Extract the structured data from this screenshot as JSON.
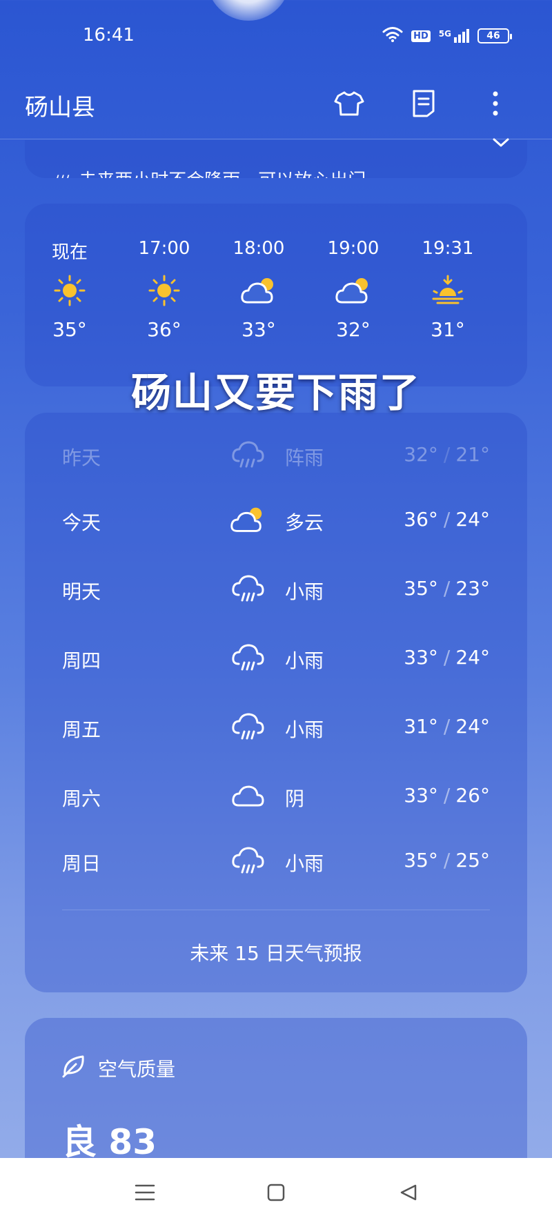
{
  "status_bar": {
    "time": "16:41",
    "hd": "HD",
    "network": "5G",
    "battery": "46",
    "icons": [
      "wifi-icon",
      "hd-icon",
      "5g-signal-icon",
      "battery-icon"
    ]
  },
  "header": {
    "city": "砀山县",
    "icons": [
      "tshirt-icon",
      "note-icon",
      "more-vertical-icon"
    ]
  },
  "alert": {
    "text": "未来两小时不会降雨，可以放心出门"
  },
  "overlay_title": "砀山又要下雨了",
  "hourly": [
    {
      "label": "现在",
      "icon": "sun-icon",
      "temp": "35°"
    },
    {
      "label": "17:00",
      "icon": "sun-icon",
      "temp": "36°"
    },
    {
      "label": "18:00",
      "icon": "partly-cloudy-icon",
      "temp": "33°"
    },
    {
      "label": "19:00",
      "icon": "partly-cloudy-icon",
      "temp": "32°"
    },
    {
      "label": "19:31",
      "icon": "sunset-icon",
      "temp": "31°"
    }
  ],
  "daily": [
    {
      "day": "昨天",
      "icon": "shower-icon",
      "cond": "阵雨",
      "high": "32°",
      "low": "21°",
      "sep": "/"
    },
    {
      "day": "今天",
      "icon": "partly-cloudy-icon",
      "cond": "多云",
      "high": "36°",
      "low": "24°",
      "sep": "/"
    },
    {
      "day": "明天",
      "icon": "rain-icon",
      "cond": "小雨",
      "high": "35°",
      "low": "23°",
      "sep": "/"
    },
    {
      "day": "周四",
      "icon": "rain-icon",
      "cond": "小雨",
      "high": "33°",
      "low": "24°",
      "sep": "/"
    },
    {
      "day": "周五",
      "icon": "rain-icon",
      "cond": "小雨",
      "high": "31°",
      "low": "24°",
      "sep": "/"
    },
    {
      "day": "周六",
      "icon": "cloudy-icon",
      "cond": "阴",
      "high": "33°",
      "low": "26°",
      "sep": "/"
    },
    {
      "day": "周日",
      "icon": "rain-icon",
      "cond": "小雨",
      "high": "35°",
      "low": "25°",
      "sep": "/"
    }
  ],
  "forecast_link": "未来 15 日天气预报",
  "air_quality": {
    "title": "空气质量",
    "value": "良 83",
    "icon": "leaf-icon"
  },
  "colors": {
    "sun": "#f9c22e",
    "bg_top": "#2b56d2",
    "bg_bottom": "#98b0ea"
  },
  "nav": [
    "menu-icon",
    "home-icon",
    "back-icon"
  ]
}
